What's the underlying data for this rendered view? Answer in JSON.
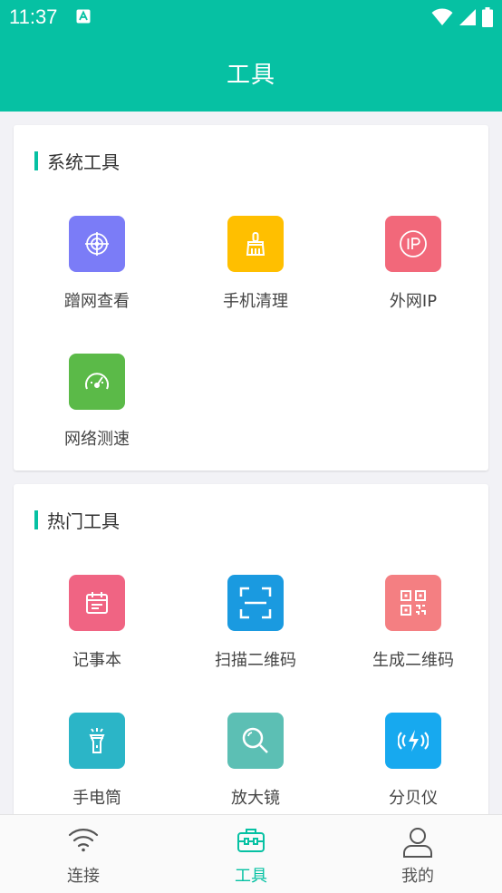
{
  "status_bar": {
    "time": "11:37",
    "notification_icon": "a-badge-icon",
    "icons": [
      "wifi-icon",
      "signal-icon",
      "battery-icon"
    ]
  },
  "app_bar": {
    "title": "工具"
  },
  "colors": {
    "primary": "#06c1a3",
    "router_view": "#7b7cf7",
    "phone_clean": "#ffbf00",
    "external_ip": "#f2687a",
    "speed_test": "#5bba48",
    "notepad": "#f06483",
    "scan_qr": "#1a9ae0",
    "generate_qr": "#f47f82",
    "flashlight": "#2bb5c7",
    "magnifier": "#5cbfb4",
    "decibel": "#17a9ef"
  },
  "sections": {
    "system": {
      "title": "系统工具",
      "tools": [
        {
          "label": "蹭网查看",
          "icon": "radar-target-icon"
        },
        {
          "label": "手机清理",
          "icon": "broom-icon"
        },
        {
          "label": "外网IP",
          "icon": "ip-icon"
        },
        {
          "label": "网络测速",
          "icon": "speedometer-icon"
        }
      ]
    },
    "popular": {
      "title": "热门工具",
      "tools": [
        {
          "label": "记事本",
          "icon": "calendar-note-icon"
        },
        {
          "label": "扫描二维码",
          "icon": "scan-frame-icon"
        },
        {
          "label": "生成二维码",
          "icon": "qr-code-icon"
        },
        {
          "label": "手电筒",
          "icon": "flashlight-icon"
        },
        {
          "label": "放大镜",
          "icon": "magnifier-icon"
        },
        {
          "label": "分贝仪",
          "icon": "decibel-icon"
        }
      ]
    }
  },
  "bottom_nav": {
    "tabs": [
      {
        "label": "连接",
        "icon": "wifi-icon",
        "active": false
      },
      {
        "label": "工具",
        "icon": "toolbox-icon",
        "active": true
      },
      {
        "label": "我的",
        "icon": "user-icon",
        "active": false
      }
    ]
  }
}
